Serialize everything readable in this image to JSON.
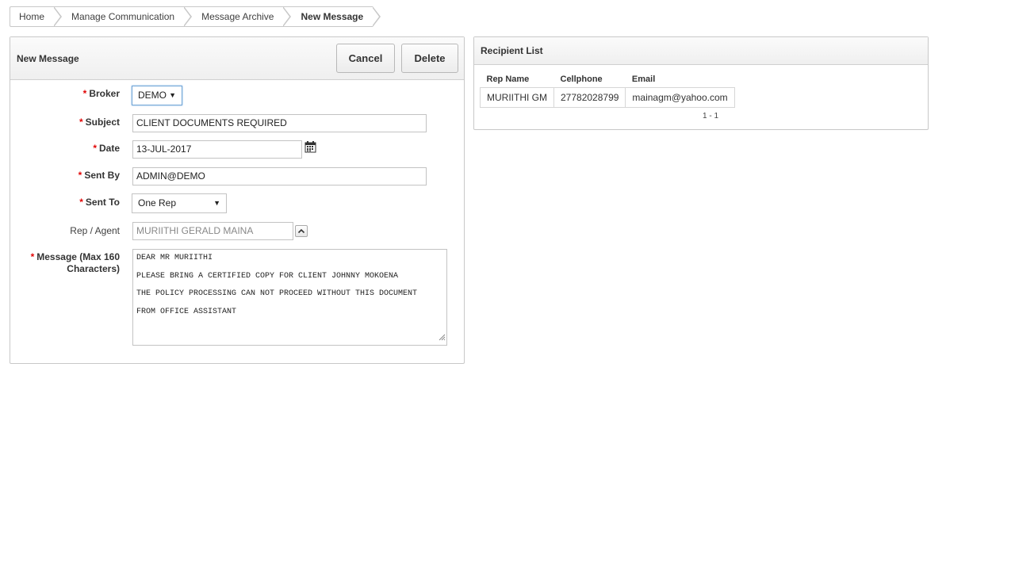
{
  "breadcrumb": {
    "items": [
      {
        "label": "Home"
      },
      {
        "label": "Manage Communication"
      },
      {
        "label": "Message Archive"
      },
      {
        "label": "New Message"
      }
    ]
  },
  "new_message": {
    "title": "New Message",
    "cancel_label": "Cancel",
    "delete_label": "Delete",
    "required_mark": "*",
    "broker": {
      "label": "Broker",
      "value": "DEMO"
    },
    "subject": {
      "label": "Subject",
      "value": "CLIENT DOCUMENTS REQUIRED"
    },
    "date": {
      "label": "Date",
      "value": "13-JUL-2017"
    },
    "sent_by": {
      "label": "Sent By",
      "value": "ADMIN@DEMO"
    },
    "sent_to": {
      "label": "Sent To",
      "value": "One Rep"
    },
    "rep_agent": {
      "label": "Rep / Agent",
      "value": "MURIITHI GERALD MAINA"
    },
    "message": {
      "label_line1": "Message (Max 160",
      "label_line2": "Characters)",
      "lines": [
        "DEAR MR MURIITHI",
        "PLEASE BRING A CERTIFIED COPY FOR CLIENT JOHNNY MOKOENA",
        "THE POLICY PROCESSING CAN NOT PROCEED WITHOUT THIS DOCUMENT",
        "FROM OFFICE ASSISTANT"
      ]
    }
  },
  "recipient_list": {
    "title": "Recipient List",
    "columns": [
      "Rep Name",
      "Cellphone",
      "Email"
    ],
    "rows": [
      [
        "MURIITHI GM",
        "27782028799",
        "mainagm@yahoo.com"
      ]
    ],
    "pagination": "1 - 1"
  },
  "icons": {
    "calendar": "calendar-icon",
    "popup_lov": "chevron-up-icon",
    "select_caret": "caret-down-icon",
    "resize": "resize-grip-icon"
  },
  "colors": {
    "required": "#e10505",
    "focus_border": "#6fa4d6",
    "border": "#c8c8c8"
  }
}
